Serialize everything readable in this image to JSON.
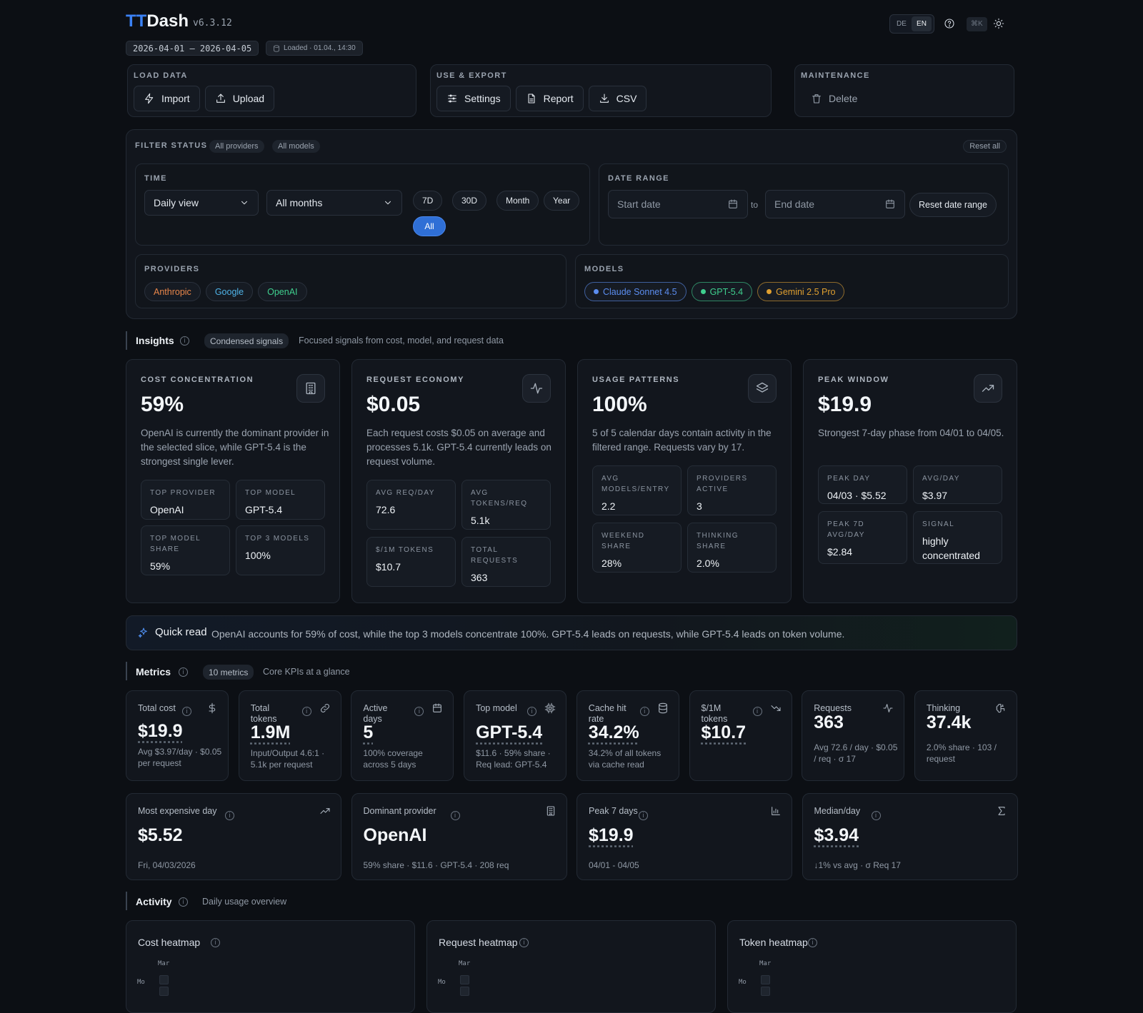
{
  "app": {
    "brand_a": "TT",
    "brand_b": "Dash",
    "version": "v6.3.12",
    "date_range": "2026-04-01 – 2026-04-05",
    "loaded": "Loaded · 01.04., 14:30",
    "lang_de": "DE",
    "lang_en": "EN",
    "shortcut": "⌘K",
    "accent": "#3b82f6"
  },
  "actions": {
    "load": {
      "title": "LOAD DATA",
      "import": "Import",
      "upload": "Upload"
    },
    "use": {
      "title": "USE & EXPORT",
      "settings": "Settings",
      "report": "Report",
      "csv": "CSV"
    },
    "maint": {
      "title": "MAINTENANCE",
      "delete": "Delete"
    }
  },
  "filter": {
    "title": "FILTER STATUS",
    "providers_badge": "All providers",
    "models_badge": "All models",
    "reset_all": "Reset all",
    "time": {
      "title": "TIME",
      "view": "Daily view",
      "months": "All months",
      "presets": [
        "7D",
        "30D",
        "Month",
        "Year"
      ],
      "all": "All"
    },
    "date": {
      "title": "DATE RANGE",
      "start_placeholder": "Start date",
      "to": "to",
      "end_placeholder": "End date",
      "reset": "Reset date range"
    },
    "providers": {
      "title": "PROVIDERS",
      "items": [
        {
          "label": "Anthropic",
          "color": "#e8864a"
        },
        {
          "label": "Google",
          "color": "#4fb3e8"
        },
        {
          "label": "OpenAI",
          "color": "#3fcf8e"
        }
      ]
    },
    "models": {
      "title": "MODELS",
      "items": [
        {
          "label": "Claude Sonnet 4.5",
          "color": "#5b8def"
        },
        {
          "label": "GPT-5.4",
          "color": "#3fcf8e"
        },
        {
          "label": "Gemini 2.5 Pro",
          "color": "#e0a030"
        }
      ]
    }
  },
  "insights": {
    "title": "Insights",
    "badge": "Condensed signals",
    "sub": "Focused signals from cost, model, and request data",
    "cards": [
      {
        "label": "COST CONCENTRATION",
        "value": "59%",
        "desc": "OpenAI is currently the dominant provider in the selected slice, while GPT-5.4 is the strongest single lever.",
        "icon": "building-icon",
        "stats": [
          {
            "k": "TOP PROVIDER",
            "v": "OpenAI"
          },
          {
            "k": "TOP MODEL",
            "v": "GPT-5.4"
          },
          {
            "k": "TOP MODEL SHARE",
            "v": "59%"
          },
          {
            "k": "TOP 3 MODELS",
            "v": "100%"
          }
        ]
      },
      {
        "label": "REQUEST ECONOMY",
        "value": "$0.05",
        "desc": "Each request costs $0.05 on average and processes 5.1k. GPT-5.4 currently leads on request volume.",
        "icon": "activity-icon",
        "stats": [
          {
            "k": "AVG REQ/DAY",
            "v": "72.6"
          },
          {
            "k": "AVG TOKENS/REQ",
            "v": "5.1k"
          },
          {
            "k": "$/1M TOKENS",
            "v": "$10.7"
          },
          {
            "k": "TOTAL REQUESTS",
            "v": "363"
          }
        ]
      },
      {
        "label": "USAGE PATTERNS",
        "value": "100%",
        "desc": "5 of 5 calendar days contain activity in the filtered range. Requests vary by 17.",
        "icon": "layers-icon",
        "stats": [
          {
            "k": "AVG MODELS/ENTRY",
            "v": "2.2"
          },
          {
            "k": "PROVIDERS ACTIVE",
            "v": "3"
          },
          {
            "k": "WEEKEND SHARE",
            "v": "28%"
          },
          {
            "k": "THINKING SHARE",
            "v": "2.0%"
          }
        ]
      },
      {
        "label": "PEAK WINDOW",
        "value": "$19.9",
        "desc": "Strongest 7-day phase from 04/01 to 04/05.",
        "icon": "trending-up-icon",
        "stats": [
          {
            "k": "PEAK DAY",
            "v": "04/03 · $5.52"
          },
          {
            "k": "AVG/DAY",
            "v": "$3.97"
          },
          {
            "k": "PEAK 7D AVG/DAY",
            "v": "$2.84"
          },
          {
            "k": "SIGNAL",
            "v": "highly concentrated"
          }
        ]
      }
    ]
  },
  "quick": {
    "title": "Quick read",
    "text": "OpenAI accounts for 59% of cost, while the top 3 models concentrate 100%. GPT-5.4 leads on requests, while GPT-5.4 leads on token volume."
  },
  "metrics": {
    "title": "Metrics",
    "badge": "10 metrics",
    "sub": "Core KPIs at a glance",
    "row1": [
      {
        "title": "Total cost",
        "value": "$19.9",
        "sub": "Avg $3.97/day · $0.05 per request",
        "icon": "dollar-icon"
      },
      {
        "title": "Total tokens",
        "value": "1.9M",
        "sub": "Input/Output 4.6:1 · 5.1k per request",
        "icon": "link-icon"
      },
      {
        "title": "Active days",
        "value": "5",
        "sub": "100% coverage across 5 days",
        "icon": "calendar-icon"
      },
      {
        "title": "Top model",
        "value": "GPT-5.4",
        "sub": "$11.6 · 59% share · Req lead: GPT-5.4",
        "icon": "cpu-icon"
      },
      {
        "title": "Cache hit rate",
        "value": "34.2%",
        "sub": "34.2% of all tokens via cache read",
        "icon": "database-icon"
      },
      {
        "title": "$/1M tokens",
        "value": "$10.7",
        "sub": "",
        "icon": "trending-down-icon"
      },
      {
        "title": "Requests",
        "value": "363",
        "sub": "Avg 72.6 / day · $0.05 / req · σ 17",
        "icon": "activity-icon"
      },
      {
        "title": "Thinking",
        "value": "37.4k",
        "sub": "2.0% share · 103 / request",
        "icon": "brain-icon"
      }
    ],
    "row2": [
      {
        "title": "Most expensive day",
        "value": "$5.52",
        "sub": "Fri, 04/03/2026",
        "icon": "trending-up-icon"
      },
      {
        "title": "Dominant provider",
        "value": "OpenAI",
        "sub": "59% share · $11.6 · GPT-5.4 · 208 req",
        "icon": "building-icon"
      },
      {
        "title": "Peak 7 days",
        "value": "$19.9",
        "sub": "04/01 - 04/05",
        "icon": "bar-chart-icon"
      },
      {
        "title": "Median/day",
        "value": "$3.94",
        "sub": "↓1% vs avg · σ Req 17",
        "icon": "sigma-icon"
      }
    ]
  },
  "activity": {
    "title": "Activity",
    "sub": "Daily usage overview",
    "heatmaps": [
      {
        "title": "Cost heatmap",
        "month": "Mar",
        "day": "Mo"
      },
      {
        "title": "Request heatmap",
        "month": "Mar",
        "day": "Mo"
      },
      {
        "title": "Token heatmap",
        "month": "Mar",
        "day": "Mo"
      }
    ]
  }
}
